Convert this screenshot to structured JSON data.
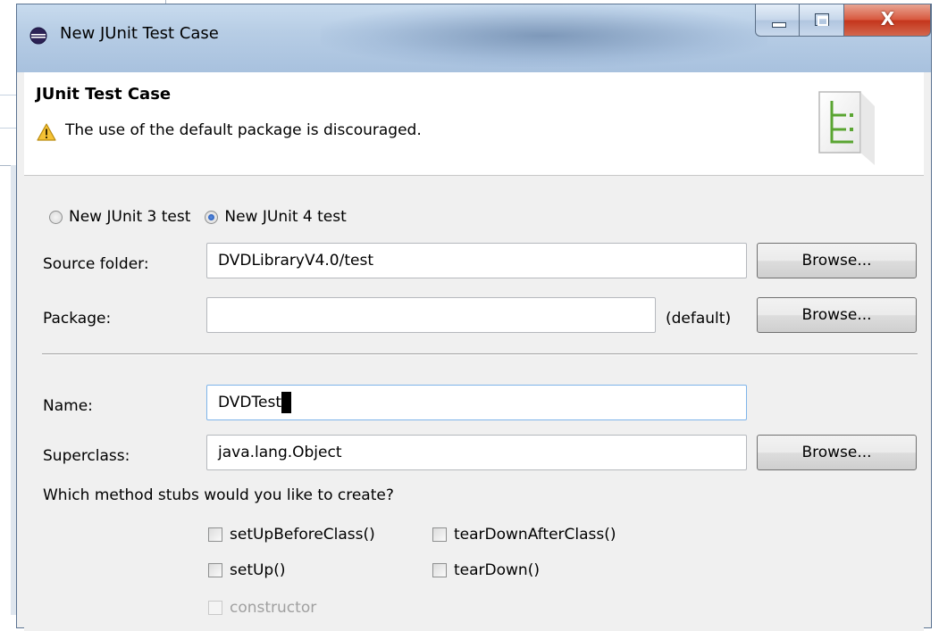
{
  "window": {
    "title": "New JUnit Test Case",
    "controls": {
      "close_glyph": "X"
    }
  },
  "header": {
    "title": "JUnit Test Case",
    "message": "The use of the default package is discouraged.",
    "message_icon": "warning-icon",
    "wizard_icon": "junit-wizard-icon"
  },
  "version": {
    "options": [
      {
        "label": "New JUnit 3 test",
        "selected": false
      },
      {
        "label": "New JUnit 4 test",
        "selected": true
      }
    ]
  },
  "form": {
    "source_folder": {
      "label": "Source folder:",
      "value": "DVDLibraryV4.0/test",
      "button": "Browse..."
    },
    "package": {
      "label": "Package:",
      "value": "",
      "suffix": "(default)",
      "button": "Browse..."
    },
    "name": {
      "label": "Name:",
      "value": "DVDTest"
    },
    "superclass": {
      "label": "Superclass:",
      "value": "java.lang.Object",
      "button": "Browse..."
    }
  },
  "stubs": {
    "question": "Which method stubs would you like to create?",
    "items": [
      {
        "label": "setUpBeforeClass()",
        "checked": false,
        "enabled": true
      },
      {
        "label": "tearDownAfterClass()",
        "checked": false,
        "enabled": true
      },
      {
        "label": "setUp()",
        "checked": false,
        "enabled": true
      },
      {
        "label": "tearDown()",
        "checked": false,
        "enabled": true
      },
      {
        "label": "constructor",
        "checked": false,
        "enabled": false
      }
    ]
  },
  "colors": {
    "titlebar": "#b7cde5",
    "close_button": "#c4341b",
    "dialog_bg": "#f0f0f0",
    "header_bg": "#ffffff",
    "radio_selected": "#1a4fb0"
  }
}
